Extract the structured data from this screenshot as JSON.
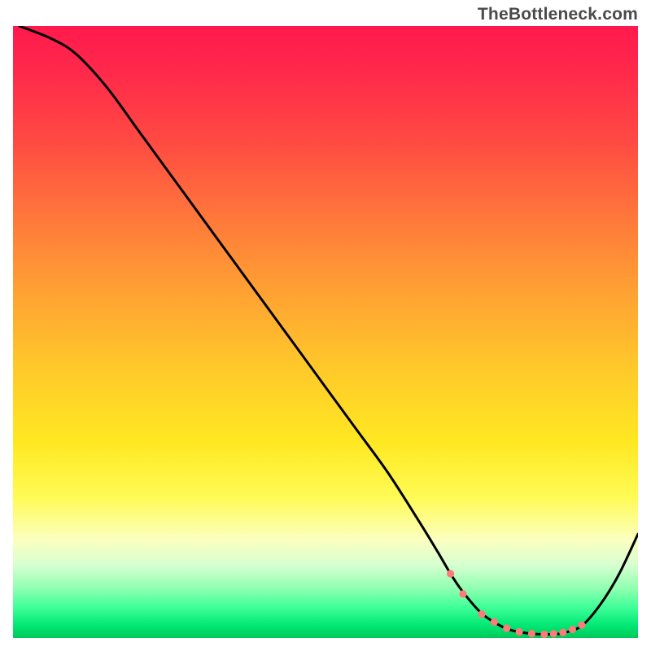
{
  "attribution": "TheBottleneck.com",
  "chart_data": {
    "type": "line",
    "title": "",
    "xlabel": "",
    "ylabel": "",
    "xlim": [
      0,
      100
    ],
    "ylim": [
      0,
      100
    ],
    "series": [
      {
        "name": "curve",
        "x": [
          1,
          6,
          10,
          15,
          20,
          25,
          30,
          35,
          40,
          45,
          50,
          55,
          60,
          65,
          68,
          70,
          72,
          75,
          78,
          80,
          83,
          86,
          88,
          91,
          94,
          97,
          100
        ],
        "values": [
          100,
          98,
          95.5,
          90,
          83,
          76,
          69,
          62,
          55,
          48,
          41,
          34,
          27,
          19,
          14,
          10.5,
          7.5,
          4,
          2,
          1.2,
          0.7,
          0.6,
          0.8,
          2,
          5.5,
          10.5,
          17
        ]
      }
    ],
    "markers": {
      "name": "highlight-band",
      "x": [
        70,
        72,
        75,
        77,
        79,
        81,
        83,
        85,
        86.5,
        88,
        89.5,
        91
      ],
      "values": [
        10.5,
        7.2,
        3.9,
        2.6,
        1.6,
        1.0,
        0.7,
        0.6,
        0.7,
        0.9,
        1.4,
        2.1
      ],
      "color": "#ff7a78",
      "radius": 4.6
    },
    "colors": {
      "curve": "#000000",
      "marker": "#ff7a78",
      "gradient_top": "#ff1a4d",
      "gradient_bottom": "#00c85a"
    }
  }
}
